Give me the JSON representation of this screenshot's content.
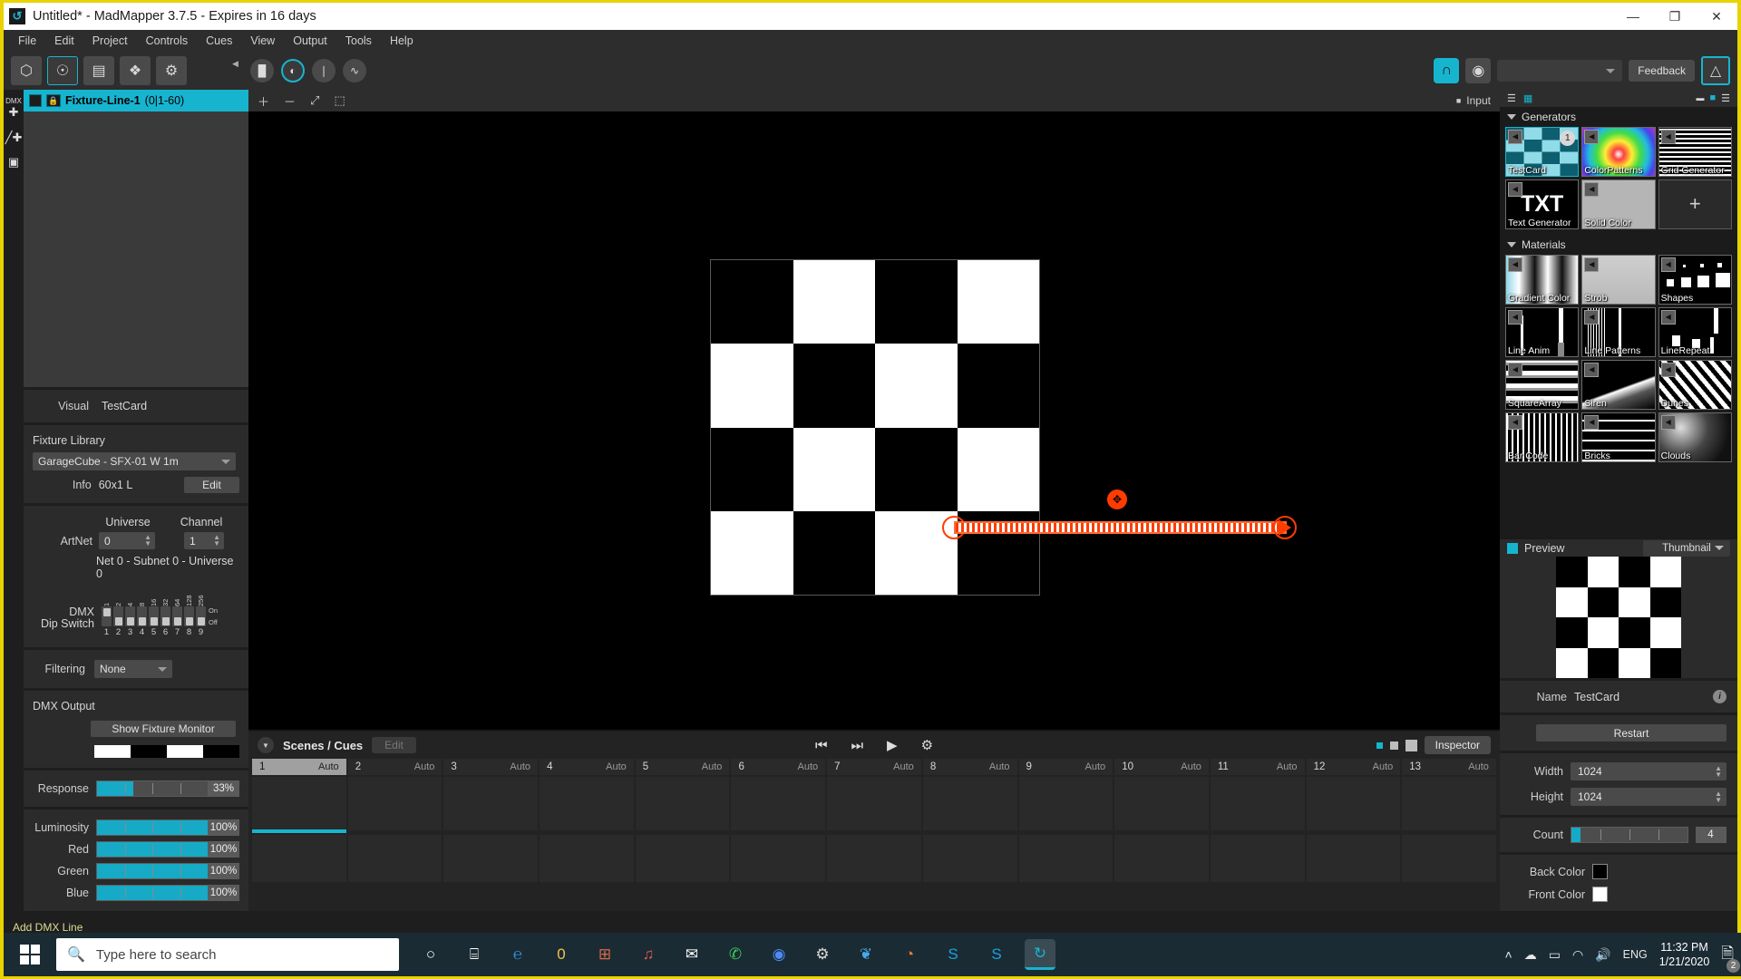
{
  "window": {
    "title": "Untitled* - MadMapper 3.7.5 - Expires in 16 days",
    "minimize": "—",
    "maximize": "❐",
    "close": "✕",
    "app_icon": "madmapper-icon"
  },
  "menubar": {
    "items": [
      "File",
      "Edit",
      "Project",
      "Controls",
      "Cues",
      "View",
      "Output",
      "Tools",
      "Help"
    ]
  },
  "toolbar": {
    "tools": [
      {
        "name": "surfaces-tool",
        "glyph": "⬡"
      },
      {
        "name": "fixtures-tool",
        "glyph": "☉"
      },
      {
        "name": "dmx-monitor-tool",
        "glyph": "▤"
      },
      {
        "name": "modules-tool",
        "glyph": "❖"
      },
      {
        "name": "preferences-tool",
        "glyph": "⚙"
      }
    ],
    "collapse_glyph": "◀",
    "transport": [
      {
        "name": "pause-button",
        "glyph": "▐▌"
      },
      {
        "name": "play-cue-button",
        "glyph": "◐"
      },
      {
        "name": "stop-button",
        "glyph": "❘"
      },
      {
        "name": "fade-button",
        "glyph": "∿"
      }
    ],
    "snap_glyph": "∩",
    "eye_glyph": "◉",
    "preset_select_value": "",
    "feedback_label": "Feedback",
    "export_glyph": "△"
  },
  "left_rail": [
    {
      "name": "add-dmx-line",
      "label": "DMX",
      "glyph": "✚"
    },
    {
      "name": "add-line",
      "glyph": "╱✚"
    },
    {
      "name": "add-group",
      "glyph": "▣"
    }
  ],
  "fixtures": {
    "tab": {
      "name": "Fixture-Line-1",
      "range": "(0|1-60)"
    },
    "actions": [
      {
        "name": "add-fixture-button",
        "glyph": "＋"
      },
      {
        "name": "remove-fixture-button",
        "glyph": "－"
      },
      {
        "name": "expand-fixture-button",
        "glyph": "⤢"
      },
      {
        "name": "select-fixture-button",
        "glyph": "⬚"
      }
    ]
  },
  "inspector": {
    "visual_label": "Visual",
    "visual_value": "TestCard",
    "fixture_library_label": "Fixture Library",
    "fixture_library_value": "GarageCube - SFX-01 W 1m",
    "info_label": "Info",
    "info_value": "60x1 L",
    "edit_label": "Edit",
    "universe_label": "Universe",
    "channel_label": "Channel",
    "artnet_label": "ArtNet",
    "universe_value": "0",
    "channel_value": "1",
    "net_info": "Net 0 - Subnet 0 - Universe 0",
    "dmx_label_line1": "DMX",
    "dmx_label_line2": "Dip Switch",
    "dip_top_labels": [
      "1",
      "2",
      "4",
      "8",
      "16",
      "32",
      "64",
      "128",
      "256"
    ],
    "dip_bottom_labels": [
      "1",
      "2",
      "3",
      "4",
      "5",
      "6",
      "7",
      "8",
      "9"
    ],
    "dip_states": [
      "on",
      "off",
      "off",
      "off",
      "off",
      "off",
      "off",
      "off",
      "off"
    ],
    "dip_on_label": "On",
    "dip_off_label": "Off",
    "filtering_label": "Filtering",
    "filtering_value": "None",
    "dmx_output_label": "DMX Output",
    "show_fixture_monitor_label": "Show Fixture Monitor",
    "output_bar": [
      "#ffffff",
      "#000000",
      "#ffffff",
      "#000000"
    ],
    "sliders": [
      {
        "name": "response",
        "label": "Response",
        "value": "33%",
        "percent": 33
      },
      {
        "name": "luminosity",
        "label": "Luminosity",
        "value": "100%",
        "percent": 100
      },
      {
        "name": "red",
        "label": "Red",
        "value": "100%",
        "percent": 100
      },
      {
        "name": "green",
        "label": "Green",
        "value": "100%",
        "percent": 100
      },
      {
        "name": "blue",
        "label": "Blue",
        "value": "100%",
        "percent": 100
      }
    ]
  },
  "statusbar": {
    "text": "Add DMX Line"
  },
  "canvas": {
    "head_right_label": "Input",
    "head_right_glyph": "■",
    "checker_rows": 4,
    "checker_cols": 4,
    "move_handle_glyph": "✥"
  },
  "cues": {
    "caret_glyph": "▼",
    "title": "Scenes / Cues",
    "edit_label": "Edit",
    "transport": [
      {
        "name": "previous-cue-button",
        "glyph": "⏮"
      },
      {
        "name": "next-cue-button",
        "glyph": "⏭"
      },
      {
        "name": "play-button",
        "glyph": "▶"
      },
      {
        "name": "cue-settings-button",
        "glyph": "⚙"
      }
    ],
    "inspector_label": "Inspector",
    "columns": [
      {
        "num": "1",
        "mode": "Auto",
        "selected": true
      },
      {
        "num": "2",
        "mode": "Auto",
        "selected": false
      },
      {
        "num": "3",
        "mode": "Auto",
        "selected": false
      },
      {
        "num": "4",
        "mode": "Auto",
        "selected": false
      },
      {
        "num": "5",
        "mode": "Auto",
        "selected": false
      },
      {
        "num": "6",
        "mode": "Auto",
        "selected": false
      },
      {
        "num": "7",
        "mode": "Auto",
        "selected": false
      },
      {
        "num": "8",
        "mode": "Auto",
        "selected": false
      },
      {
        "num": "9",
        "mode": "Auto",
        "selected": false
      },
      {
        "num": "10",
        "mode": "Auto",
        "selected": false
      },
      {
        "num": "11",
        "mode": "Auto",
        "selected": false
      },
      {
        "num": "12",
        "mode": "Auto",
        "selected": false
      },
      {
        "num": "13",
        "mode": "Auto",
        "selected": false
      }
    ]
  },
  "library": {
    "header_icons": [
      {
        "name": "list-view-icon",
        "glyph": "☰"
      },
      {
        "name": "grid-view-icon",
        "glyph": "▦"
      }
    ],
    "header_right": [
      {
        "name": "collapse-icon",
        "glyph": "▬"
      },
      {
        "name": "cyan-indicator",
        "glyph": "■"
      },
      {
        "name": "menu-icon",
        "glyph": "☰"
      }
    ],
    "groups": [
      {
        "name": "Generators",
        "tiles": [
          {
            "label": "TestCard",
            "kind": "checker-cyan",
            "selected": true,
            "badge": "1"
          },
          {
            "label": "ColorPatterns",
            "kind": "colorwheel",
            "selected": false
          },
          {
            "label": "Grid Generator",
            "kind": "grid",
            "selected": false
          },
          {
            "label": "Text Generator",
            "kind": "txt",
            "selected": false
          },
          {
            "label": "Solid Color",
            "kind": "solid",
            "selected": false
          },
          {
            "label": "",
            "kind": "plus",
            "selected": false
          }
        ]
      },
      {
        "name": "Materials",
        "tiles": [
          {
            "label": "Gradient Color",
            "kind": "gradient",
            "selected": false
          },
          {
            "label": "Strob",
            "kind": "strob",
            "selected": false
          },
          {
            "label": "Shapes",
            "kind": "shapes",
            "selected": false
          },
          {
            "label": "Line Anim",
            "kind": "lineanim",
            "selected": false
          },
          {
            "label": "Line Patterns",
            "kind": "linepat",
            "selected": false
          },
          {
            "label": "LineRepeat",
            "kind": "linerepeat",
            "selected": false
          },
          {
            "label": "SquareArray",
            "kind": "squarearray",
            "selected": false
          },
          {
            "label": "Siren",
            "kind": "siren",
            "selected": false
          },
          {
            "label": "Dunes",
            "kind": "dunes",
            "selected": false
          },
          {
            "label": "Bar Code",
            "kind": "barcode",
            "selected": false
          },
          {
            "label": "Bricks",
            "kind": "bricks",
            "selected": false
          },
          {
            "label": "Clouds",
            "kind": "clouds",
            "selected": false
          }
        ]
      }
    ]
  },
  "preview": {
    "label": "Preview",
    "mode": "Thumbnail",
    "name_label": "Name",
    "name_value": "TestCard",
    "info_glyph": "i",
    "restart_label": "Restart",
    "width_label": "Width",
    "width_value": "1024",
    "height_label": "Height",
    "height_value": "1024",
    "count_label": "Count",
    "count_value": "4",
    "count_percent": 8,
    "back_color_label": "Back Color",
    "back_color": "#000000",
    "front_color_label": "Front Color",
    "front_color": "#ffffff"
  },
  "taskbar": {
    "search_placeholder": "Type here to search",
    "search_icon": "search-icon",
    "apps": [
      {
        "name": "cortana-icon",
        "glyph": "○",
        "color": "#ffffff"
      },
      {
        "name": "task-view-icon",
        "glyph": "⌸",
        "color": "#ffffff"
      },
      {
        "name": "edge-icon",
        "glyph": "℮",
        "color": "#2b8fd4"
      },
      {
        "name": "file-explorer-icon",
        "glyph": "὜0",
        "color": "#f2c14e"
      },
      {
        "name": "microsoft-store-icon",
        "glyph": "⊞",
        "color": "#d96a4a"
      },
      {
        "name": "music-icon",
        "glyph": "♫",
        "color": "#e0574b"
      },
      {
        "name": "mail-icon",
        "glyph": "✉",
        "color": "#ffffff"
      },
      {
        "name": "whatsapp-icon",
        "glyph": "✆",
        "color": "#3ecb5c"
      },
      {
        "name": "chrome-icon",
        "glyph": "◉",
        "color": "#4c8bf5"
      },
      {
        "name": "settings-icon",
        "glyph": "⚙",
        "color": "#d8d8d8"
      },
      {
        "name": "twitter-icon",
        "glyph": "❦",
        "color": "#49a9e8"
      },
      {
        "name": "reddit-icon",
        "glyph": "◔",
        "color": "#f07a35"
      },
      {
        "name": "skype-icon",
        "glyph": "S",
        "color": "#1ba2e0"
      },
      {
        "name": "skype-business-icon",
        "glyph": "S",
        "color": "#1ba2e0"
      },
      {
        "name": "madmapper-icon",
        "glyph": "↻",
        "color": "#17b4cf"
      }
    ],
    "tray": [
      {
        "name": "show-hidden-icons",
        "glyph": "˄"
      },
      {
        "name": "onedrive-icon",
        "glyph": "☁"
      },
      {
        "name": "battery-icon",
        "glyph": "▭"
      },
      {
        "name": "wifi-icon",
        "glyph": "◠"
      },
      {
        "name": "volume-icon",
        "glyph": "🔊"
      }
    ],
    "language": "ENG",
    "time": "11:32 PM",
    "date": "1/21/2020",
    "notification_count": "2",
    "notification_icon": "notifications-icon"
  },
  "colors": {
    "accent": "#17b4cf",
    "fixture_line": "#ff3c00",
    "yellow_border": "#e8d200"
  }
}
